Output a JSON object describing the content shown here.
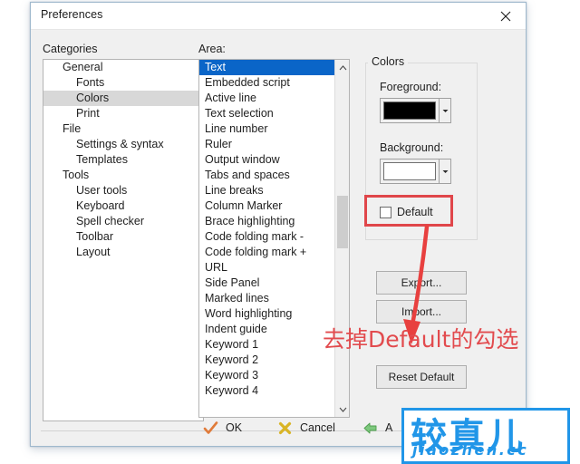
{
  "window": {
    "title": "Preferences",
    "close_icon": "close-icon"
  },
  "categories": {
    "label": "Categories",
    "items": [
      {
        "label": "General",
        "indent": 0,
        "selected": false
      },
      {
        "label": "Fonts",
        "indent": 1,
        "selected": false
      },
      {
        "label": "Colors",
        "indent": 1,
        "selected": true
      },
      {
        "label": "Print",
        "indent": 1,
        "selected": false
      },
      {
        "label": "File",
        "indent": 0,
        "selected": false
      },
      {
        "label": "Settings & syntax",
        "indent": 1,
        "selected": false
      },
      {
        "label": "Templates",
        "indent": 1,
        "selected": false
      },
      {
        "label": "Tools",
        "indent": 0,
        "selected": false
      },
      {
        "label": "User tools",
        "indent": 1,
        "selected": false
      },
      {
        "label": "Keyboard",
        "indent": 1,
        "selected": false
      },
      {
        "label": "Spell checker",
        "indent": 1,
        "selected": false
      },
      {
        "label": "Toolbar",
        "indent": 1,
        "selected": false
      },
      {
        "label": "Layout",
        "indent": 1,
        "selected": false
      }
    ]
  },
  "area": {
    "label": "Area:",
    "selected_value": "Text",
    "items": [
      {
        "label": "Text",
        "selected": true
      },
      {
        "label": "Embedded script",
        "selected": false
      },
      {
        "label": "Active line",
        "selected": false
      },
      {
        "label": "Text selection",
        "selected": false
      },
      {
        "label": "Line number",
        "selected": false
      },
      {
        "label": "Ruler",
        "selected": false
      },
      {
        "label": "Output window",
        "selected": false
      },
      {
        "label": "Tabs and spaces",
        "selected": false
      },
      {
        "label": "Line breaks",
        "selected": false
      },
      {
        "label": "Column Marker",
        "selected": false
      },
      {
        "label": "Brace highlighting",
        "selected": false
      },
      {
        "label": "Code folding mark -",
        "selected": false
      },
      {
        "label": "Code folding mark +",
        "selected": false
      },
      {
        "label": "URL",
        "selected": false
      },
      {
        "label": "Side Panel",
        "selected": false
      },
      {
        "label": "Marked lines",
        "selected": false
      },
      {
        "label": "Word highlighting",
        "selected": false
      },
      {
        "label": "Indent guide",
        "selected": false
      },
      {
        "label": "Keyword 1",
        "selected": false
      },
      {
        "label": "Keyword 2",
        "selected": false
      },
      {
        "label": "Keyword 3",
        "selected": false
      },
      {
        "label": "Keyword 4",
        "selected": false
      }
    ],
    "scroll_up_icon": "chevron-up-icon",
    "scroll_down_icon": "chevron-down-icon"
  },
  "colors": {
    "group_title": "Colors",
    "foreground_label": "Foreground:",
    "foreground_value": "#000000",
    "background_label": "Background:",
    "background_value": "#ffffff",
    "dropdown_icon": "chevron-down-icon",
    "default_checkbox_label": "Default",
    "default_checkbox_checked": false,
    "export_button": "Export...",
    "import_button": "Import...",
    "reset_button": "Reset Default"
  },
  "footer": {
    "ok_label": "OK",
    "ok_icon": "checkmark-icon",
    "cancel_label": "Cancel",
    "cancel_icon": "x-mark-icon",
    "apply_label": "A",
    "apply_icon": "green-left-arrow-icon"
  },
  "annotations": {
    "highlight_color": "#e0464a",
    "arrow_color": "#e8403f",
    "note_text": "去掉Default的勾选"
  },
  "watermark": {
    "cn_text": "较真儿",
    "en_text": "jiaozhen.cc",
    "color": "#2196e8"
  }
}
